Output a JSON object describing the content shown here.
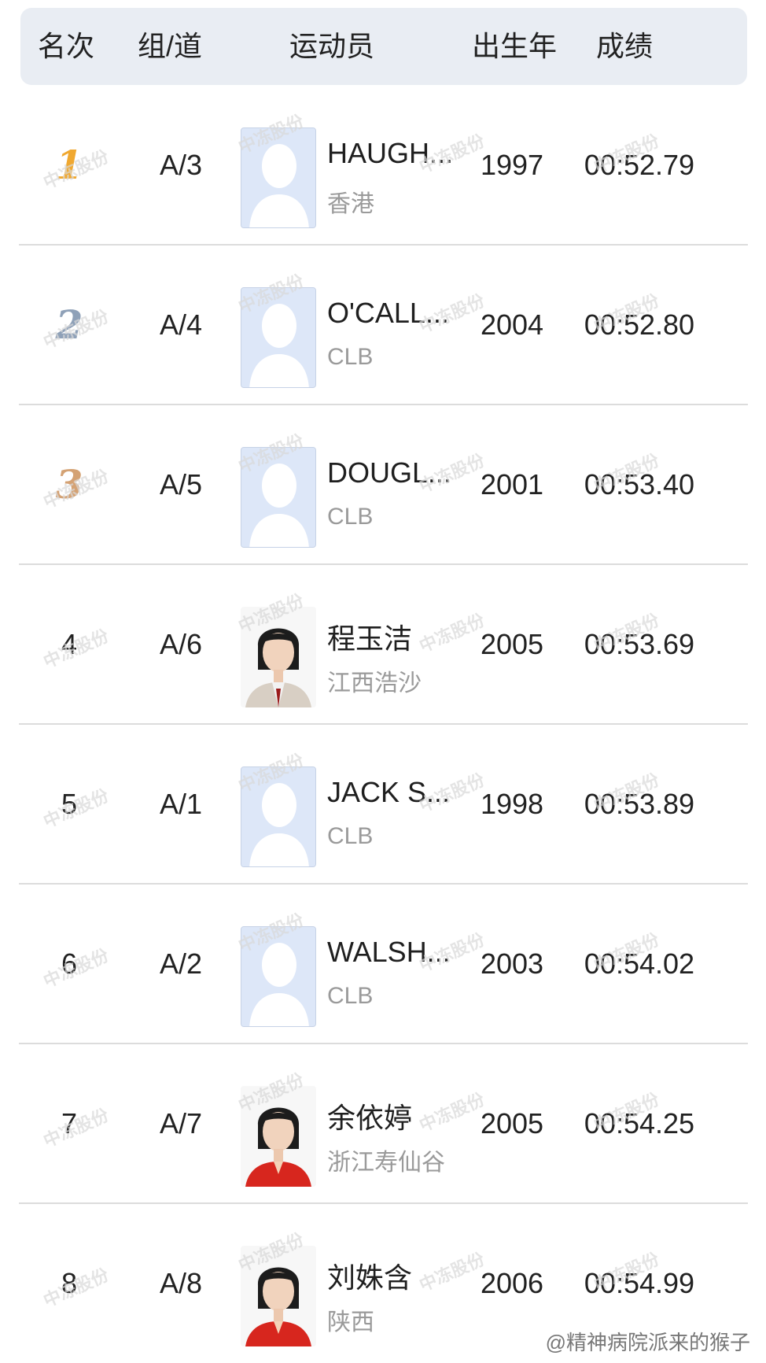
{
  "header": {
    "rank": "名次",
    "lane": "组/道",
    "athlete": "运动员",
    "birth_year": "出生年",
    "result": "成绩"
  },
  "rows": [
    {
      "rank": "1",
      "lane": "A/3",
      "name": "HAUGH...",
      "team": "香港",
      "year": "1997",
      "time": "00:52.79",
      "medal": "gold",
      "photo": "placeholder"
    },
    {
      "rank": "2",
      "lane": "A/4",
      "name": "O'CALL...",
      "team": "CLB",
      "year": "2004",
      "time": "00:52.80",
      "medal": "silver",
      "photo": "placeholder"
    },
    {
      "rank": "3",
      "lane": "A/5",
      "name": "DOUGL...",
      "team": "CLB",
      "year": "2001",
      "time": "00:53.40",
      "medal": "bronze",
      "photo": "placeholder"
    },
    {
      "rank": "4",
      "lane": "A/6",
      "name": "程玉洁",
      "team": "江西浩沙",
      "year": "2005",
      "time": "00:53.69",
      "medal": "",
      "photo": "portrait-uniform"
    },
    {
      "rank": "5",
      "lane": "A/1",
      "name": "JACK S...",
      "team": "CLB",
      "year": "1998",
      "time": "00:53.89",
      "medal": "",
      "photo": "placeholder"
    },
    {
      "rank": "6",
      "lane": "A/2",
      "name": "WALSH...",
      "team": "CLB",
      "year": "2003",
      "time": "00:54.02",
      "medal": "",
      "photo": "placeholder"
    },
    {
      "rank": "7",
      "lane": "A/7",
      "name": "余依婷",
      "team": "浙江寿仙谷",
      "year": "2005",
      "time": "00:54.25",
      "medal": "",
      "photo": "portrait-team-jacket"
    },
    {
      "rank": "8",
      "lane": "A/8",
      "name": "刘姝含",
      "team": "陕西",
      "year": "2006",
      "time": "00:54.99",
      "medal": "",
      "photo": "portrait-team-jacket"
    }
  ],
  "colors": {
    "gold": "#f0a830",
    "silver": "#8fa1b8",
    "bronze": "#d4a274",
    "header_bg": "#e9edf3",
    "placeholder_bg": "#dde7f8"
  },
  "watermark": "中冻股份",
  "footer_watermark": "@精神病院派来的猴子"
}
